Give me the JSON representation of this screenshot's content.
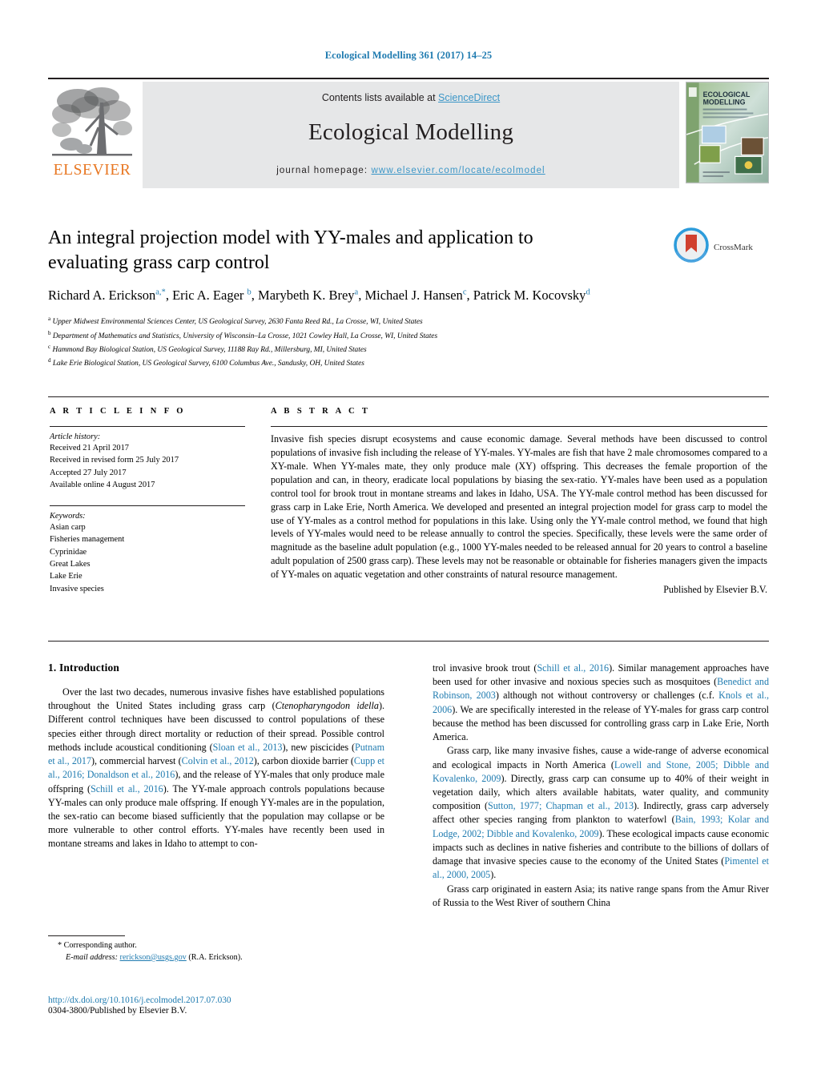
{
  "running_head": "Ecological Modelling 361 (2017) 14–25",
  "masthead": {
    "contents_prefix": "Contents lists available at ",
    "sciencedirect": "ScienceDirect",
    "journal_title": "Ecological Modelling",
    "homepage_prefix": "journal homepage: ",
    "homepage_url": "www.elsevier.com/locate/ecolmodel",
    "publisher_wordmark": "ELSEVIER",
    "cover_title_line1": "ECOLOGICAL",
    "cover_title_line2": "MODELLING",
    "accent_color": "#3b96c7",
    "band_color": "#e6e7e8",
    "elsevier_orange": "#e87722"
  },
  "crossmark": {
    "label": "CrossMark"
  },
  "article": {
    "title": "An integral projection model with YY-males and application to evaluating grass carp control",
    "authors_html": "Richard A. Erickson<sup>a,*</sup>, Eric A. Eager <sup>b</sup>, Marybeth K. Brey<sup>a</sup>, Michael J. Hansen<sup>c</sup>, Patrick M. Kocovsky<sup>d</sup>",
    "affiliations": [
      {
        "marker": "a",
        "text": "Upper Midwest Environmental Sciences Center, US Geological Survey, 2630 Fanta Reed Rd., La Crosse, WI, United States"
      },
      {
        "marker": "b",
        "text": "Department of Mathematics and Statistics, University of Wisconsin–La Crosse, 1021 Cowley Hall, La Crosse, WI, United States"
      },
      {
        "marker": "c",
        "text": "Hammond Bay Biological Station, US Geological Survey, 11188 Ray Rd., Millersburg, MI, United States"
      },
      {
        "marker": "d",
        "text": "Lake Erie Biological Station, US Geological Survey, 6100 Columbus Ave., Sandusky, OH, United States"
      }
    ]
  },
  "article_info": {
    "heading": "A R T I C L E   I N F O",
    "history_label": "Article history:",
    "history": [
      "Received 21 April 2017",
      "Received in revised form 25 July 2017",
      "Accepted 27 July 2017",
      "Available online 4 August 2017"
    ],
    "keywords_label": "Keywords:",
    "keywords": [
      "Asian carp",
      "Fisheries management",
      "Cyprinidae",
      "Great Lakes",
      "Lake Erie",
      "Invasive species"
    ]
  },
  "abstract": {
    "heading": "A B S T R A C T",
    "text": "Invasive fish species disrupt ecosystems and cause economic damage. Several methods have been discussed to control populations of invasive fish including the release of YY-males. YY-males are fish that have 2 male chromosomes compared to a XY-male. When YY-males mate, they only produce male (XY) offspring. This decreases the female proportion of the population and can, in theory, eradicate local populations by biasing the sex-ratio. YY-males have been used as a population control tool for brook trout in montane streams and lakes in Idaho, USA. The YY-male control method has been discussed for grass carp in Lake Erie, North America. We developed and presented an integral projection model for grass carp to model the use of YY-males as a control method for populations in this lake. Using only the YY-male control method, we found that high levels of YY-males would need to be release annually to control the species. Specifically, these levels were the same order of magnitude as the baseline adult population (e.g., 1000 YY-males needed to be released annual for 20 years to control a baseline adult population of 2500 grass carp). These levels may not be reasonable or obtainable for fisheries managers given the impacts of YY-males on aquatic vegetation and other constraints of natural resource management.",
    "published_by": "Published by Elsevier B.V."
  },
  "introduction": {
    "heading": "1.  Introduction",
    "left_paragraphs": [
      "Over the last two decades, numerous invasive fishes have established populations throughout the United States including grass carp (<i>Ctenopharyngodon idella</i>). Different control techniques have been discussed to control populations of these species either through direct mortality or reduction of their spread. Possible control methods include acoustical conditioning (<span class=\"cite\">Sloan et al., 2013</span>), new piscicides (<span class=\"cite\">Putnam et al., 2017</span>), commercial harvest (<span class=\"cite\">Colvin et al., 2012</span>), carbon dioxide barrier (<span class=\"cite\">Cupp et al., 2016; Donaldson et al., 2016</span>), and the release of YY-males that only produce male offspring (<span class=\"cite\">Schill et al., 2016</span>). The YY-male approach controls populations because YY-males can only produce male offspring. If enough YY-males are in the population, the sex-ratio can become biased sufficiently that the population may collapse or be more vulnerable to other control efforts. YY-males have recently been used in montane streams and lakes in Idaho to attempt to con-"
    ],
    "right_paragraphs": [
      "trol invasive brook trout (<span class=\"cite\">Schill et al., 2016</span>). Similar management approaches have been used for other invasive and noxious species such as mosquitoes (<span class=\"cite\">Benedict and Robinson, 2003</span>) although not without controversy or challenges (c.f. <span class=\"cite\">Knols et al., 2006</span>). We are specifically interested in the release of YY-males for grass carp control because the method has been discussed for controlling grass carp in Lake Erie, North America.",
      "Grass carp, like many invasive fishes, cause a wide-range of adverse economical and ecological impacts in North America (<span class=\"cite\">Lowell and Stone, 2005; Dibble and Kovalenko, 2009</span>). Directly, grass carp can consume up to 40% of their weight in vegetation daily, which alters available habitats, water quality, and community composition (<span class=\"cite\">Sutton, 1977; Chapman et al., 2013</span>). Indirectly, grass carp adversely affect other species ranging from plankton to waterfowl (<span class=\"cite\">Bain, 1993; Kolar and Lodge, 2002; Dibble and Kovalenko, 2009</span>). These ecological impacts cause economic impacts such as declines in native fisheries and contribute to the billions of dollars of damage that invasive species cause to the economy of the United States (<span class=\"cite\">Pimentel et al., 2000, 2005</span>).",
      "Grass carp originated in eastern Asia; its native range spans from the Amur River of Russia to the West River of southern China"
    ]
  },
  "footnote": {
    "corresponding_marker": "*",
    "corresponding_label": "Corresponding author.",
    "email_label": "E-mail address:",
    "email": "rerickson@usgs.gov",
    "email_attribution": "(R.A. Erickson)."
  },
  "footer": {
    "doi": "http://dx.doi.org/10.1016/j.ecolmodel.2017.07.030",
    "issn_line": "0304-3800/Published by Elsevier B.V."
  }
}
